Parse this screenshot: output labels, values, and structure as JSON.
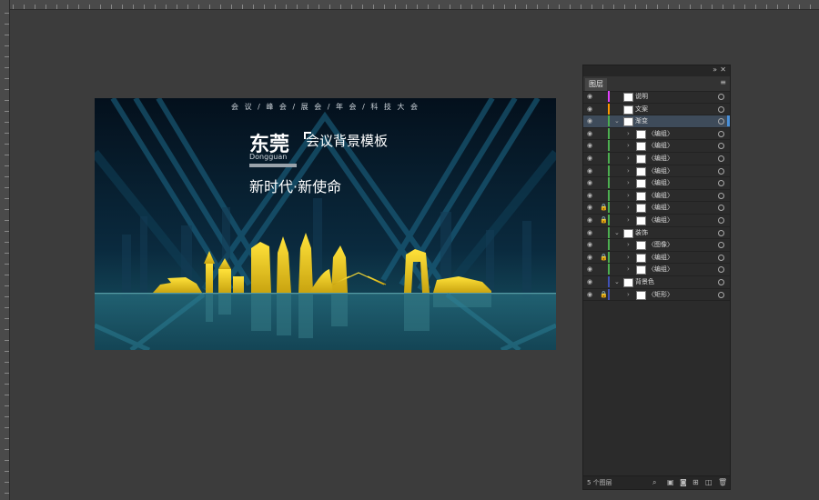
{
  "artboard": {
    "topline": "会 议   /   峰 会   /   展 会   /   年 会   /   科 技 大 会",
    "city": "东莞",
    "template_title": "会议背景模板",
    "pinyin": "Dongguan",
    "slogan": "新时代·新使命"
  },
  "layers_panel": {
    "tab_label": "图层",
    "collapse_icon": "double-chevron-icon",
    "close_icon": "close-icon",
    "menu_icon": "panel-menu-icon",
    "layers": [
      {
        "label": "说明",
        "color": "#e040fb",
        "level": 0,
        "expand": false,
        "lock": false
      },
      {
        "label": "文案",
        "color": "#ff9800",
        "level": 0,
        "expand": false,
        "lock": false
      },
      {
        "label": "渐变",
        "color": "#4caf50",
        "level": 0,
        "expand": true,
        "lock": false,
        "selected": true
      },
      {
        "label": "〈编组〉",
        "color": "#4caf50",
        "level": 1,
        "expand": false,
        "lock": false
      },
      {
        "label": "〈编组〉",
        "color": "#4caf50",
        "level": 1,
        "expand": false,
        "lock": false
      },
      {
        "label": "〈编组〉",
        "color": "#4caf50",
        "level": 1,
        "expand": false,
        "lock": false
      },
      {
        "label": "〈编组〉",
        "color": "#4caf50",
        "level": 1,
        "expand": false,
        "lock": false
      },
      {
        "label": "〈编组〉",
        "color": "#4caf50",
        "level": 1,
        "expand": false,
        "lock": false
      },
      {
        "label": "〈编组〉",
        "color": "#4caf50",
        "level": 1,
        "expand": false,
        "lock": false
      },
      {
        "label": "〈编组〉",
        "color": "#4caf50",
        "level": 1,
        "expand": false,
        "lock": true
      },
      {
        "label": "〈编组〉",
        "color": "#4caf50",
        "level": 1,
        "expand": false,
        "lock": true
      },
      {
        "label": "装饰",
        "color": "#4caf50",
        "level": 0,
        "expand": true,
        "lock": false
      },
      {
        "label": "〈图像〉",
        "color": "#4caf50",
        "level": 1,
        "expand": false,
        "lock": false
      },
      {
        "label": "〈编组〉",
        "color": "#4caf50",
        "level": 1,
        "expand": false,
        "lock": true
      },
      {
        "label": "〈编组〉",
        "color": "#4caf50",
        "level": 1,
        "expand": false,
        "lock": false
      },
      {
        "label": "背景色",
        "color": "#3f51b5",
        "level": 0,
        "expand": true,
        "lock": false
      },
      {
        "label": "〈矩形〉",
        "color": "#3f51b5",
        "level": 1,
        "expand": false,
        "lock": true
      }
    ],
    "footer_count": "5 个图层",
    "footer_icons": [
      "search-icon",
      "export-icon",
      "clipping-mask-icon",
      "new-sublayer-icon",
      "new-layer-icon",
      "trash-icon"
    ]
  }
}
